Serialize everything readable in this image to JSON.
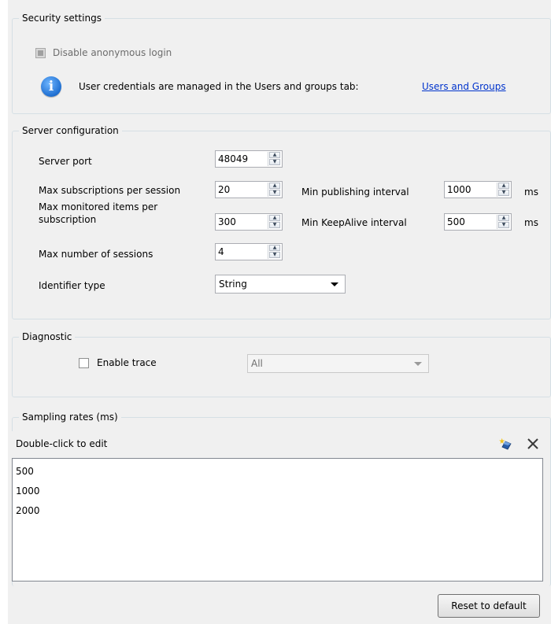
{
  "security": {
    "legend": "Security settings",
    "disable_anonymous_label": "Disable anonymous login",
    "info_text": "User credentials are managed in the Users and groups tab:",
    "link_text": "Users and Groups"
  },
  "server": {
    "legend": "Server configuration",
    "port_label": "Server port",
    "port_value": "48049",
    "max_subs_label": "Max subscriptions per session",
    "max_subs_value": "20",
    "max_items_label_1": "Max monitored items per",
    "max_items_label_2": "subscription",
    "max_items_value": "300",
    "max_sessions_label": "Max number of sessions",
    "max_sessions_value": "4",
    "identifier_label": "Identifier type",
    "identifier_value": "String",
    "min_pub_label": "Min publishing interval",
    "min_pub_value": "1000",
    "min_pub_unit": "ms",
    "min_keepalive_label": "Min KeepAlive interval",
    "min_keepalive_value": "500",
    "min_keepalive_unit": "ms"
  },
  "diagnostic": {
    "legend": "Diagnostic",
    "enable_trace_label": "Enable trace",
    "trace_level_value": "All"
  },
  "sampling": {
    "legend": "Sampling rates (ms)",
    "header": "Double-click to edit",
    "items": [
      "500",
      "1000",
      "2000"
    ]
  },
  "footer": {
    "reset_label": "Reset to default"
  }
}
